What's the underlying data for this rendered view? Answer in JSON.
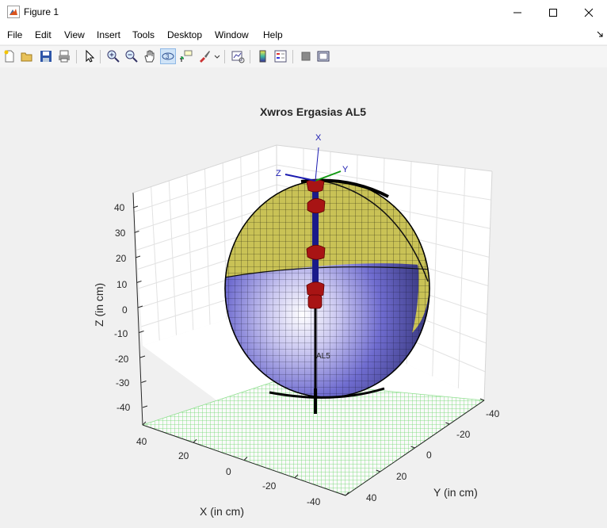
{
  "window": {
    "title": "Figure 1"
  },
  "menu": [
    "File",
    "Edit",
    "View",
    "Insert",
    "Tools",
    "Desktop",
    "Window",
    "Help"
  ],
  "toolbar_icons": [
    "new-figure",
    "open-file",
    "save",
    "print",
    "select-arrow",
    "zoom-in",
    "zoom-out",
    "pan",
    "rotate-3d",
    "data-cursor",
    "brush",
    "link-plot",
    "colorbar",
    "legend",
    "hide-plot-tools",
    "show-plot-tools"
  ],
  "plot": {
    "title": "Xwros Ergasias AL5",
    "xlabel": "X (in cm)",
    "ylabel": "Y (in cm)",
    "zlabel": "Z (in cm)",
    "z_ticks": [
      "40",
      "30",
      "20",
      "10",
      "0",
      "-10",
      "-20",
      "-30",
      "-40"
    ],
    "x_ticks": [
      "40",
      "20",
      "0",
      "-20",
      "-40"
    ],
    "y_ticks": [
      "-40",
      "-20",
      "0",
      "20",
      "40"
    ],
    "frame_labels": {
      "x": "X",
      "y": "Y",
      "z": "Z"
    },
    "robot_label": "AL5"
  },
  "chart_data": {
    "type": "surface3d",
    "title": "Xwros Ergasias AL5",
    "xlabel": "X (in cm)",
    "ylabel": "Y (in cm)",
    "zlabel": "Z (in cm)",
    "xlim": [
      -40,
      40
    ],
    "ylim": [
      -40,
      40
    ],
    "zlim": [
      -40,
      40
    ],
    "grid": true,
    "objects": [
      "yellow spherical workspace surface (upper cap)",
      "blue-violet spherical workspace surface (lower part)",
      "green mesh ground plane at z=-40",
      "AL5 robot arm links and joints along z axis"
    ],
    "colors": {
      "upper_surface": "#c9c256",
      "lower_surface": "#5b5bb0",
      "ground": "#7ee07e",
      "joints": "#b01515",
      "links": "#101080"
    }
  }
}
